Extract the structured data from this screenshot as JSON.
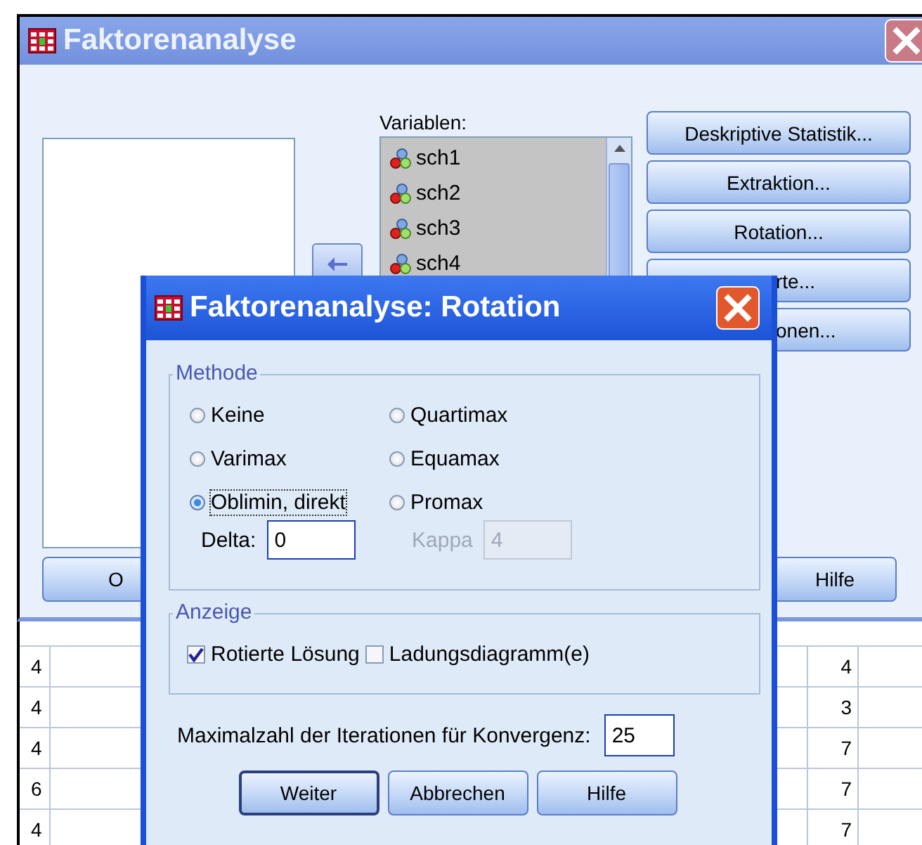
{
  "main_window": {
    "title": "Faktorenanalyse",
    "variables_label": "Variablen:",
    "variables": [
      "sch1",
      "sch2",
      "sch3",
      "sch4"
    ],
    "side_buttons": [
      {
        "label": "Deskriptive Statistik...",
        "kind": "full"
      },
      {
        "label": "Extraktion...",
        "kind": "full"
      },
      {
        "label": "Rotation...",
        "kind": "full"
      },
      {
        "label": "rte...",
        "kind": "partial"
      },
      {
        "label": "onen...",
        "kind": "partial"
      }
    ],
    "bottom_buttons": [
      {
        "label": "O",
        "kind": "partial"
      },
      {
        "label": "Hilfe",
        "kind": "full"
      }
    ]
  },
  "data_grid": {
    "rows": [
      [
        "4",
        "4"
      ],
      [
        "4",
        "3"
      ],
      [
        "4",
        "7"
      ],
      [
        "6",
        "7"
      ],
      [
        "4",
        "7"
      ]
    ]
  },
  "rotation_dialog": {
    "title": "Faktorenanalyse: Rotation",
    "method_group": {
      "label": "Methode",
      "options": [
        {
          "label": "Keine",
          "selected": false
        },
        {
          "label": "Quartimax",
          "selected": false
        },
        {
          "label": "Varimax",
          "selected": false
        },
        {
          "label": "Equamax",
          "selected": false
        },
        {
          "label": "Oblimin, direkt",
          "selected": true
        },
        {
          "label": "Promax",
          "selected": false
        }
      ],
      "delta": {
        "label": "Delta:",
        "value": "0",
        "disabled": false
      },
      "kappa": {
        "label": "Kappa",
        "value": "4",
        "disabled": true
      }
    },
    "display_group": {
      "label": "Anzeige",
      "options": [
        {
          "label": "Rotierte Lösung",
          "checked": true
        },
        {
          "label": "Ladungsdiagramm(e)",
          "checked": false
        }
      ]
    },
    "iterations": {
      "label": "Maximalzahl der Iterationen für Konvergenz:",
      "value": "25"
    },
    "buttons": [
      {
        "label": "Weiter",
        "default": true
      },
      {
        "label": "Abbrechen",
        "default": false
      },
      {
        "label": "Hilfe",
        "default": false
      }
    ]
  }
}
